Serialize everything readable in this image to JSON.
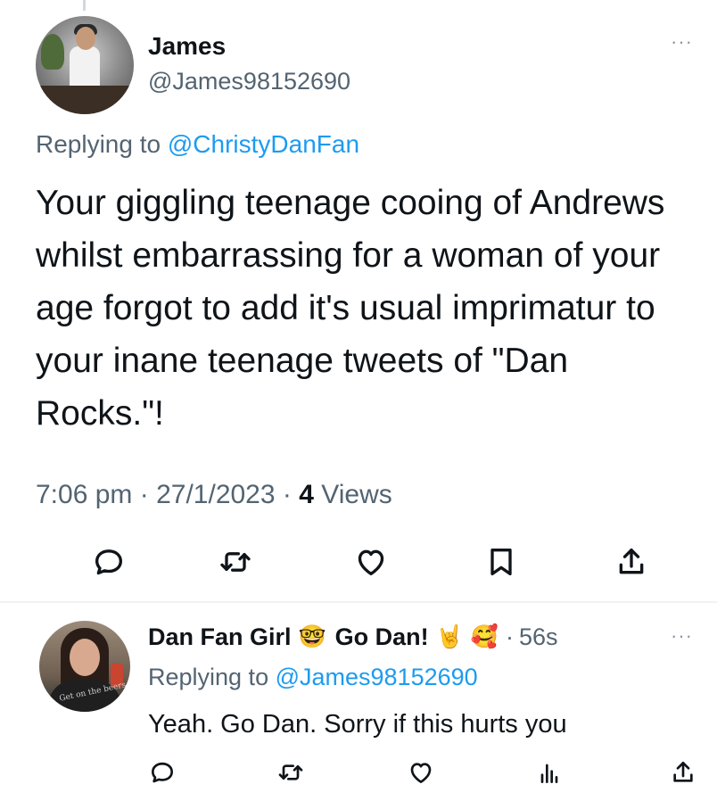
{
  "main_tweet": {
    "author_name": "James",
    "author_handle": "@James98152690",
    "replying_prefix": "Replying to ",
    "replying_to": "@ChristyDanFan",
    "text": "Your giggling teenage cooing of Andrews whilst embarrassing for a woman of your age forgot to add it's usual imprimatur to your inane teenage tweets of \"Dan Rocks.\"!",
    "time": "7:06 pm",
    "date": "27/1/2023",
    "dot": "·",
    "views_count": "4",
    "views_label": "Views",
    "more": "···"
  },
  "reply_tweet": {
    "author_name": "Dan Fan Girl",
    "emoji_nerd": "🤓",
    "author_name_extra": "Go Dan!",
    "emoji_horns": "🤘",
    "emoji_hearts": "🥰",
    "dot": "·",
    "time": "56s",
    "more": "···",
    "replying_prefix": "Replying to ",
    "replying_to": "@James98152690",
    "text": "Yeah. Go Dan. Sorry if this hurts you",
    "avatar_shirt_text": "Get on the beers"
  },
  "icons": {
    "reply": "reply-icon",
    "retweet": "retweet-icon",
    "like": "heart-icon",
    "bookmark": "bookmark-icon",
    "share": "share-icon",
    "views": "views-chart-icon"
  },
  "colors": {
    "link": "#1d9bf0",
    "secondary_text": "#536471",
    "primary_text": "#0f1419",
    "divider": "#eff3f4"
  }
}
